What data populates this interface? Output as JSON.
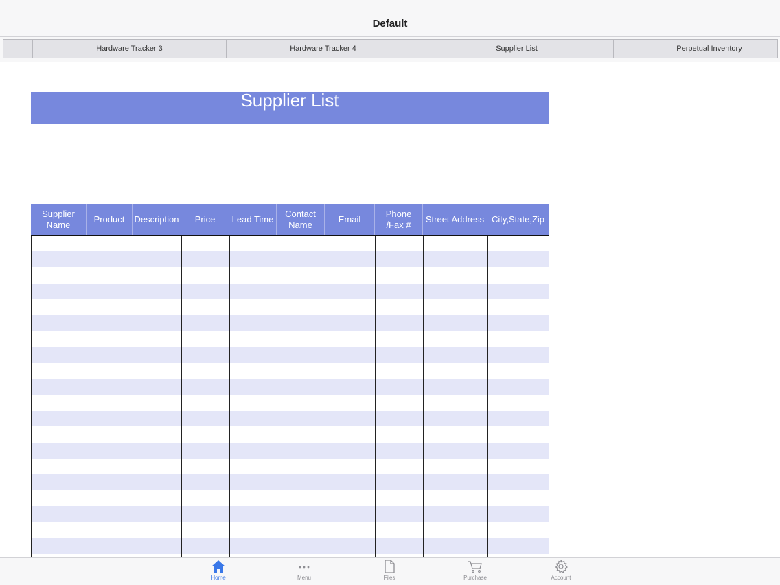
{
  "window": {
    "title": "Default"
  },
  "tabs": [
    {
      "label": ""
    },
    {
      "label": "Hardware Tracker 3"
    },
    {
      "label": "Hardware Tracker 4"
    },
    {
      "label": "Supplier List"
    },
    {
      "label": "Perpetual Inventory"
    }
  ],
  "sheet": {
    "banner_title": "Supplier List",
    "columns": [
      "Supplier\nName",
      "Product",
      "Description",
      "Price",
      "Lead Time",
      "Contact\nName",
      "Email",
      "Phone\n/Fax #",
      "Street Address",
      "City,State,Zip"
    ],
    "colors": {
      "header_bg": "#7788dd",
      "stripe_alt": "#e4e6f8"
    }
  },
  "bottom_nav": {
    "items": [
      {
        "label": "Home",
        "icon": "home-icon",
        "active": true
      },
      {
        "label": "Menu",
        "icon": "more-dots-icon",
        "active": false
      },
      {
        "label": "Files",
        "icon": "file-icon",
        "active": false
      },
      {
        "label": "Purchase",
        "icon": "cart-icon",
        "active": false
      },
      {
        "label": "Account",
        "icon": "gear-icon",
        "active": false
      }
    ],
    "active_color": "#3a78e8",
    "inactive_color": "#8e8e93"
  }
}
